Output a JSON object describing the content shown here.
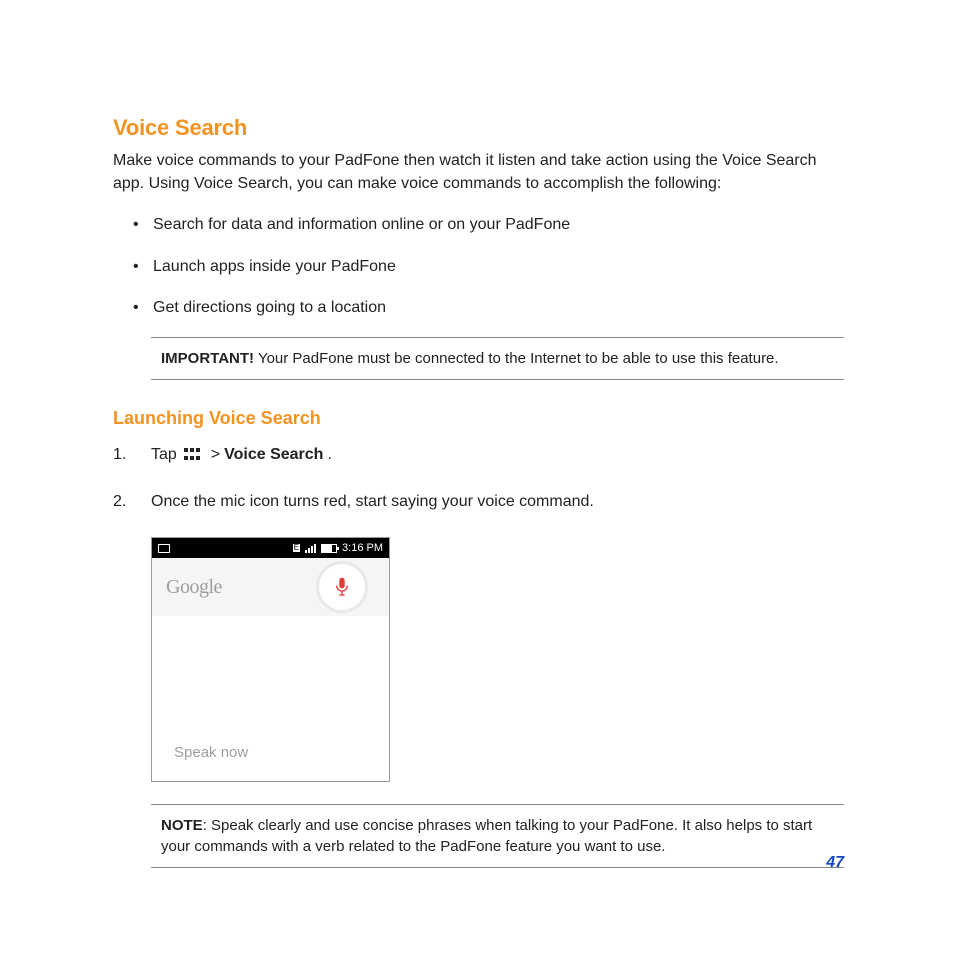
{
  "heading": "Voice Search",
  "intro": "Make voice commands to your PadFone then watch it listen and take action using the Voice Search app. Using Voice Search, you can make voice commands to accomplish the following:",
  "bullets": [
    "Search for data and information online or on your PadFone",
    "Launch apps inside your PadFone",
    "Get directions going to a location"
  ],
  "important": {
    "label": "IMPORTANT!",
    "text": " Your PadFone must be connected to the Internet to be able to use this feature."
  },
  "subheading": "Launching Voice Search",
  "step1": {
    "prefix": "Tap ",
    "sep": " > ",
    "bold": "Voice Search",
    "suffix": "."
  },
  "step2": "Once the mic icon turns red, start saying your voice command.",
  "screenshot": {
    "time": "3:16 PM",
    "logo": "Google",
    "prompt": "Speak now"
  },
  "note": {
    "label": "NOTE",
    "text": ": Speak clearly and use concise phrases when talking to your PadFone. It also helps to start your commands with a verb related to the PadFone feature you want to use."
  },
  "page_number": "47"
}
